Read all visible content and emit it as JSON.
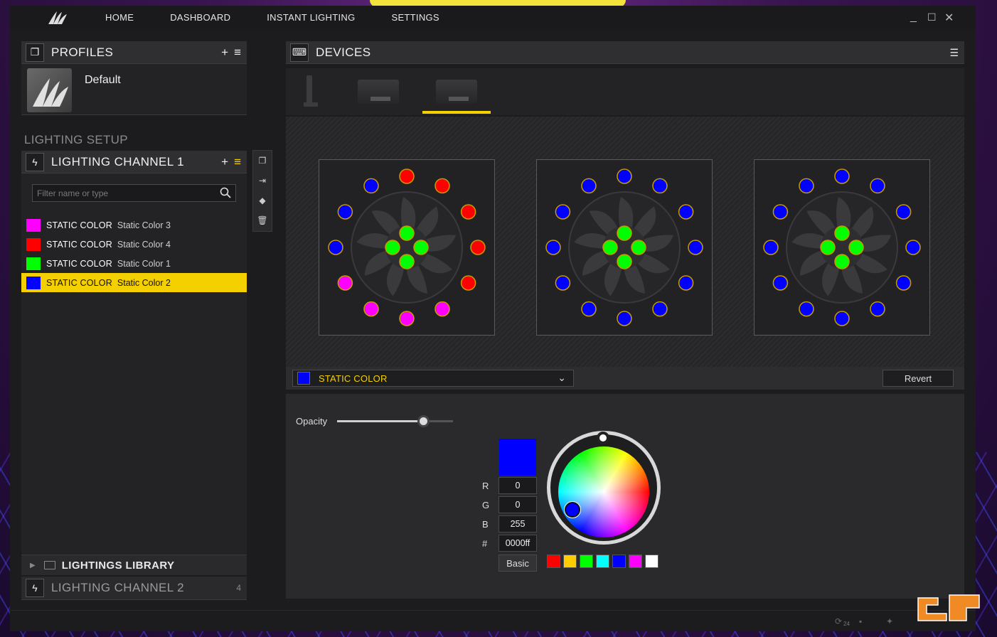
{
  "nav": {
    "items": [
      "HOME",
      "DASHBOARD",
      "INSTANT LIGHTING",
      "SETTINGS"
    ],
    "window_controls": [
      "minimize-icon",
      "maximize-icon",
      "close-icon"
    ]
  },
  "profiles": {
    "title": "PROFILES",
    "items": [
      {
        "name": "Default"
      }
    ]
  },
  "lighting_setup": {
    "label": "LIGHTING SETUP",
    "channel1": {
      "title": "LIGHTING CHANNEL 1",
      "filter_placeholder": "Filter name or type",
      "layers": [
        {
          "type": "STATIC COLOR",
          "name": "Static Color 3",
          "color": "#ff00ff",
          "selected": false
        },
        {
          "type": "STATIC COLOR",
          "name": "Static Color 4",
          "color": "#ff0000",
          "selected": false
        },
        {
          "type": "STATIC COLOR",
          "name": "Static Color 1",
          "color": "#00ff00",
          "selected": false
        },
        {
          "type": "STATIC COLOR",
          "name": "Static Color 2",
          "color": "#0000ff",
          "selected": true
        }
      ]
    },
    "library": {
      "label": "LIGHTINGS LIBRARY"
    },
    "channel2": {
      "title": "LIGHTING CHANNEL 2",
      "count": "4"
    }
  },
  "devices": {
    "title": "DEVICES",
    "tabs": [
      "headset-stand",
      "lighting-node-1",
      "lighting-node-2"
    ],
    "active_tab": 2,
    "fans": [
      {
        "ring": [
          "#ff0000",
          "#ff0000",
          "#ff0000",
          "#ff0000",
          "#ff0000",
          "#ff00ff",
          "#ff00ff",
          "#ff00ff",
          "#ff00ff",
          "#0000ff",
          "#0000ff",
          "#0000ff"
        ],
        "center": "#00ff00"
      },
      {
        "ring": [
          "#0000ff",
          "#0000ff",
          "#0000ff",
          "#0000ff",
          "#0000ff",
          "#0000ff",
          "#0000ff",
          "#0000ff",
          "#0000ff",
          "#0000ff",
          "#0000ff",
          "#0000ff"
        ],
        "center": "#00ff00"
      },
      {
        "ring": [
          "#0000ff",
          "#0000ff",
          "#0000ff",
          "#0000ff",
          "#0000ff",
          "#0000ff",
          "#0000ff",
          "#0000ff",
          "#0000ff",
          "#0000ff",
          "#0000ff",
          "#0000ff"
        ],
        "center": "#00ff00"
      }
    ]
  },
  "effect": {
    "type": "STATIC COLOR",
    "color": "#0000ff",
    "revert_label": "Revert",
    "opacity_label": "Opacity",
    "opacity": 0.75,
    "r_label": "R",
    "g_label": "G",
    "b_label": "B",
    "hex_label": "#",
    "r": "0",
    "g": "0",
    "b": "255",
    "hex": "0000ff",
    "basic_label": "Basic",
    "presets": [
      "#ff0000",
      "#ffcc00",
      "#00ff00",
      "#00ffff",
      "#0000ff",
      "#ff00ff",
      "#ffffff"
    ]
  },
  "status": {
    "notification_count": "24"
  },
  "accent": "#f5d000"
}
